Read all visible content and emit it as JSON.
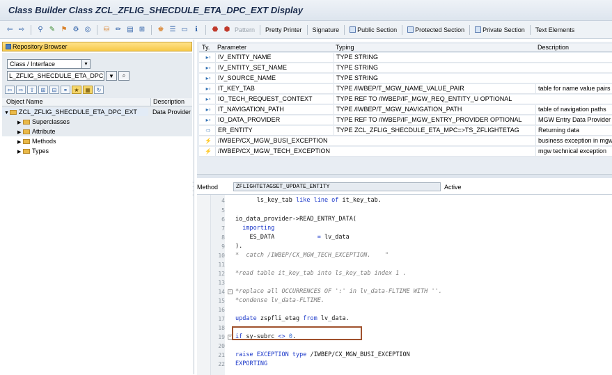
{
  "window": {
    "title": "Class Builder Class ZCL_ZFLIG_SHECDULE_ETA_DPC_EXT Display"
  },
  "toolbar": {
    "pattern": "Pattern",
    "pretty_printer": "Pretty Printer",
    "signature": "Signature",
    "public_section": "Public Section",
    "protected_section": "Protected Section",
    "private_section": "Private Section",
    "text_elements": "Text Elements"
  },
  "repository": {
    "header": "Repository Browser",
    "object_type": "Class / Interface",
    "object_name": "L_ZFLIG_SHECDULE_ETA_DPC_E ×",
    "tree_columns": {
      "name": "Object Name",
      "description": "Description"
    },
    "root": {
      "label": "ZCL_ZFLIG_SHECDULE_ETA_DPC_EXT",
      "description": "Data Provider Se"
    },
    "children": [
      "Superclasses",
      "Attribute",
      "Methods",
      "Types"
    ]
  },
  "params": {
    "columns": {
      "ty": "Ty.",
      "parameter": "Parameter",
      "typing": "Typing",
      "description": "Description"
    },
    "rows": [
      {
        "icon": "importing-icon",
        "name": "IV_ENTITY_NAME",
        "typing": "TYPE STRING",
        "description": ""
      },
      {
        "icon": "importing-icon",
        "name": "IV_ENTITY_SET_NAME",
        "typing": "TYPE STRING",
        "description": ""
      },
      {
        "icon": "importing-icon",
        "name": "IV_SOURCE_NAME",
        "typing": "TYPE STRING",
        "description": ""
      },
      {
        "icon": "importing-icon",
        "name": "IT_KEY_TAB",
        "typing": "TYPE /IWBEP/T_MGW_NAME_VALUE_PAIR",
        "description": "table for name value pairs"
      },
      {
        "icon": "importing-icon",
        "name": "IO_TECH_REQUEST_CONTEXT",
        "typing": "TYPE REF TO /IWBEP/IF_MGW_REQ_ENTITY_U OPTIONAL",
        "description": ""
      },
      {
        "icon": "importing-icon",
        "name": "IT_NAVIGATION_PATH",
        "typing": "TYPE /IWBEP/T_MGW_NAVIGATION_PATH",
        "description": "table of navigation paths"
      },
      {
        "icon": "importing-icon",
        "name": "IO_DATA_PROVIDER",
        "typing": "TYPE REF TO /IWBEP/IF_MGW_ENTRY_PROVIDER OPTIONAL",
        "description": "MGW Entry Data Provider"
      },
      {
        "icon": "returning-icon",
        "name": "ER_ENTITY",
        "typing": "TYPE ZCL_ZFLIG_SHECDULE_ETA_MPC=>TS_ZFLIGHTETAG",
        "description": "Returning data"
      },
      {
        "icon": "exception-icon",
        "name": "/IWBEP/CX_MGW_BUSI_EXCEPTION",
        "typing": "",
        "description": "business exception in mgw"
      },
      {
        "icon": "exception-icon",
        "name": "/IWBEP/CX_MGW_TECH_EXCEPTION",
        "typing": "",
        "description": "mgw technical exception"
      }
    ]
  },
  "method": {
    "label": "Method",
    "name": "ZFLIGHTETAGSET_UPDATE_ENTITY",
    "status": "Active"
  },
  "editor": {
    "line_numbers": [
      "4",
      "5",
      "6",
      "7",
      "8",
      "9",
      "10",
      "11",
      "12",
      "13",
      "14",
      "15",
      "16",
      "17",
      "18",
      "19",
      "20",
      "21",
      "22"
    ]
  }
}
